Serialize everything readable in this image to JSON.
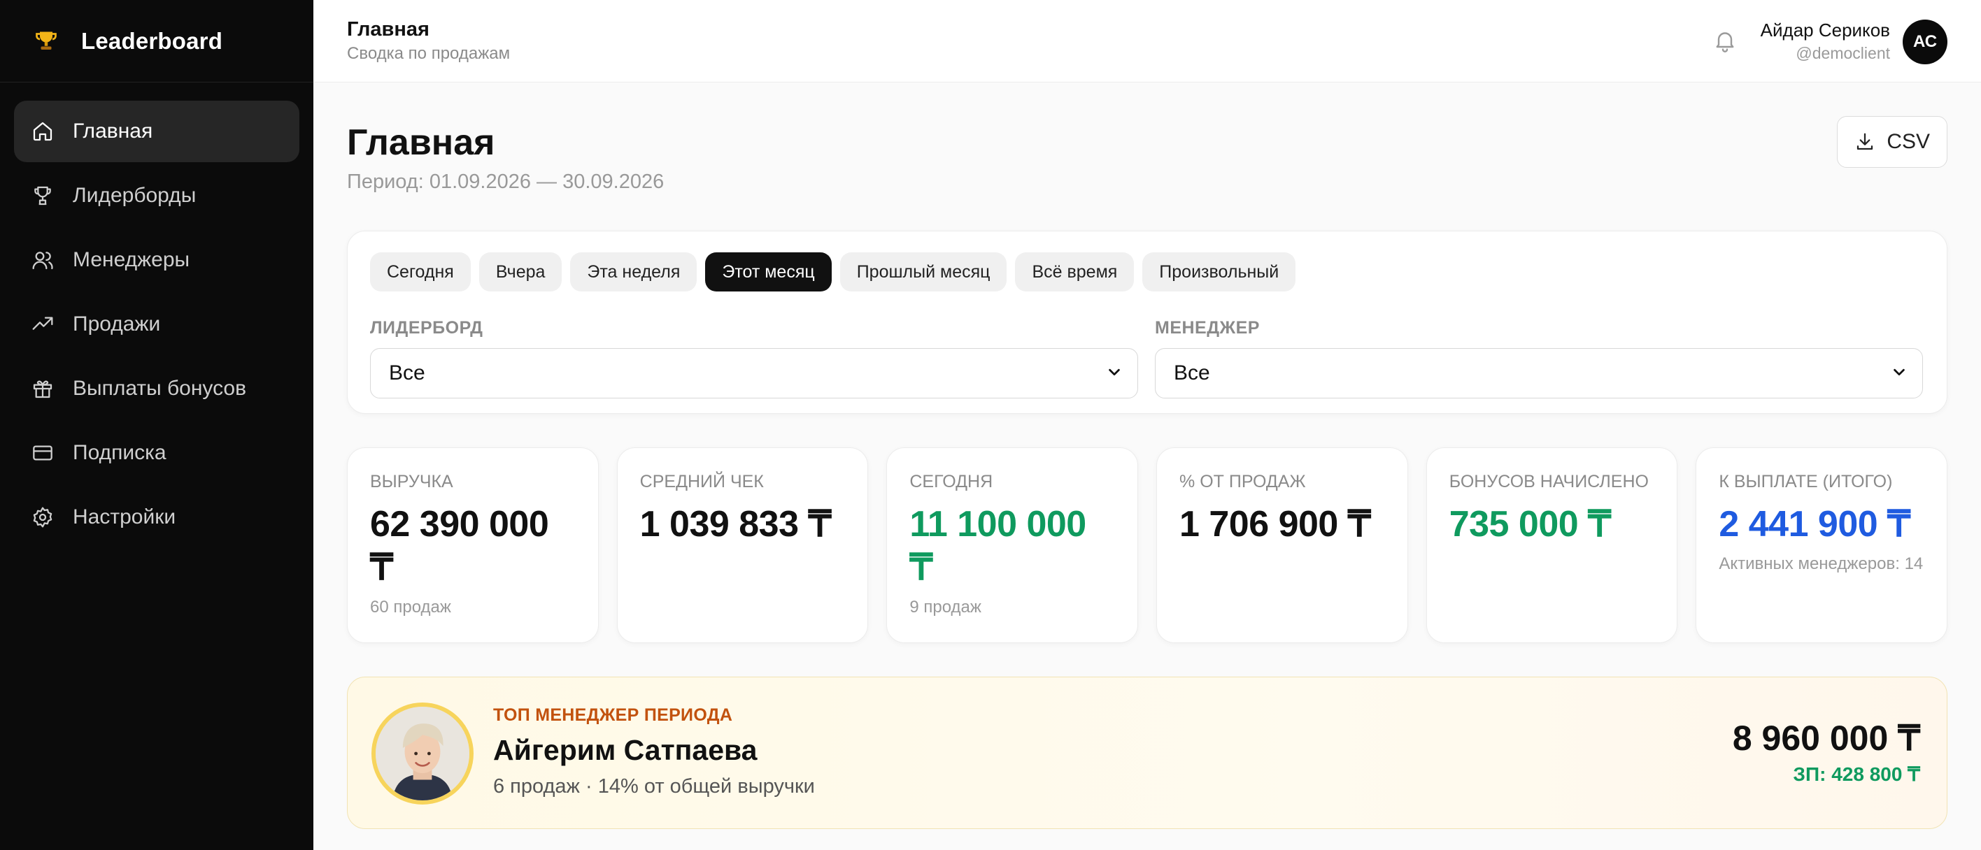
{
  "sidebar": {
    "brand": "Leaderboard",
    "items": [
      {
        "label": "Главная",
        "icon": "home-icon",
        "active": true
      },
      {
        "label": "Лидерборды",
        "icon": "trophy-icon"
      },
      {
        "label": "Менеджеры",
        "icon": "users-icon"
      },
      {
        "label": "Продажи",
        "icon": "trend-icon"
      },
      {
        "label": "Выплаты бонусов",
        "icon": "gift-icon"
      },
      {
        "label": "Подписка",
        "icon": "card-icon"
      },
      {
        "label": "Настройки",
        "icon": "gear-icon"
      }
    ]
  },
  "header": {
    "title": "Главная",
    "subtitle": "Сводка по продажам",
    "user_name": "Айдар Сериков",
    "user_handle": "@democlient",
    "avatar_initials": "АС"
  },
  "page": {
    "title": "Главная",
    "period": "Период: 01.09.2026 — 30.09.2026",
    "csv_label": "CSV"
  },
  "filters": {
    "chips": [
      "Сегодня",
      "Вчера",
      "Эта неделя",
      "Этот месяц",
      "Прошлый месяц",
      "Всё время",
      "Произвольный"
    ],
    "active_chip": "Этот месяц",
    "leaderboard_label": "ЛИДЕРБОРД",
    "leaderboard_value": "Все",
    "manager_label": "МЕНЕДЖЕР",
    "manager_value": "Все"
  },
  "stats": [
    {
      "label": "ВЫРУЧКА",
      "value": "62 390 000 ₸",
      "sub": "60 продаж"
    },
    {
      "label": "СРЕДНИЙ ЧЕК",
      "value": "1 039 833 ₸",
      "sub": ""
    },
    {
      "label": "СЕГОДНЯ",
      "value": "11 100 000 ₸",
      "sub": "9 продаж"
    },
    {
      "label": "% ОТ ПРОДАЖ",
      "value": "1 706 900 ₸",
      "sub": ""
    },
    {
      "label": "БОНУСОВ НАЧИСЛЕНО",
      "value": "735 000 ₸",
      "sub": ""
    },
    {
      "label": "К ВЫПЛАТЕ (ИТОГО)",
      "value": "2 441 900 ₸",
      "sub": "Активных менеджеров: 14"
    }
  ],
  "top_manager": {
    "label": "ТОП МЕНЕДЖЕР ПЕРИОДА",
    "name": "Айгерим Сатпаева",
    "meta": "6 продаж · 14% от общей выручки",
    "amount": "8 960 000 ₸",
    "salary": "ЗП: 428 800 ₸"
  },
  "colors": {
    "accent_green": "#0f9a5e",
    "accent_blue": "#1f5be0",
    "top_label": "#c2520e",
    "gold": "#f7d45c"
  }
}
